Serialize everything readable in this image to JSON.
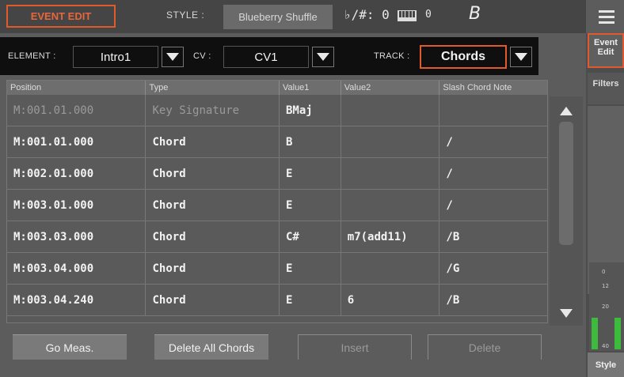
{
  "header": {
    "mode_title": "EVENT EDIT",
    "style_label": "STYLE :",
    "style_name": "Blueberry Shuffle",
    "key_signature": "♭/#: 0",
    "transpose_value": "0",
    "chord_display": "B"
  },
  "filter_bar": {
    "element_label": "ELEMENT :",
    "element_value": "Intro1",
    "cv_label": "CV :",
    "cv_value": "CV1",
    "track_label": "TRACK :",
    "track_value": "Chords"
  },
  "table": {
    "columns": [
      "Position",
      "Type",
      "Value1",
      "Value2",
      "Slash Chord Note"
    ],
    "rows": [
      {
        "position": "M:001.01.000",
        "type": "Key Signature",
        "value1": "BMaj",
        "value2": "",
        "slash": ""
      },
      {
        "position": "M:001.01.000",
        "type": "Chord",
        "value1": "B",
        "value2": "",
        "slash": "/"
      },
      {
        "position": "M:002.01.000",
        "type": "Chord",
        "value1": "E",
        "value2": "",
        "slash": "/"
      },
      {
        "position": "M:003.01.000",
        "type": "Chord",
        "value1": "E",
        "value2": "",
        "slash": "/"
      },
      {
        "position": "M:003.03.000",
        "type": "Chord",
        "value1": "C#",
        "value2": "m7(add11)",
        "slash": "/B"
      },
      {
        "position": "M:003.04.000",
        "type": "Chord",
        "value1": "E",
        "value2": "",
        "slash": "/G"
      },
      {
        "position": "M:003.04.240",
        "type": "Chord",
        "value1": "E",
        "value2": "6",
        "slash": "/B"
      }
    ]
  },
  "buttons": {
    "go_meas": "Go Meas.",
    "delete_all_chords": "Delete All Chords",
    "insert": "Insert",
    "delete": "Delete"
  },
  "side_tabs": {
    "event_edit": "Event Edit",
    "filters": "Filters",
    "style": "Style"
  },
  "meter": {
    "scale": [
      "0",
      "12",
      "20",
      "40"
    ]
  },
  "colors": {
    "accent": "#e05a2b",
    "meter_green": "#3dbb3d"
  },
  "icons": [
    "menu-icon",
    "keyboard-icon",
    "dropdown-arrow-icon",
    "scroll-up-icon",
    "scroll-down-icon"
  ]
}
